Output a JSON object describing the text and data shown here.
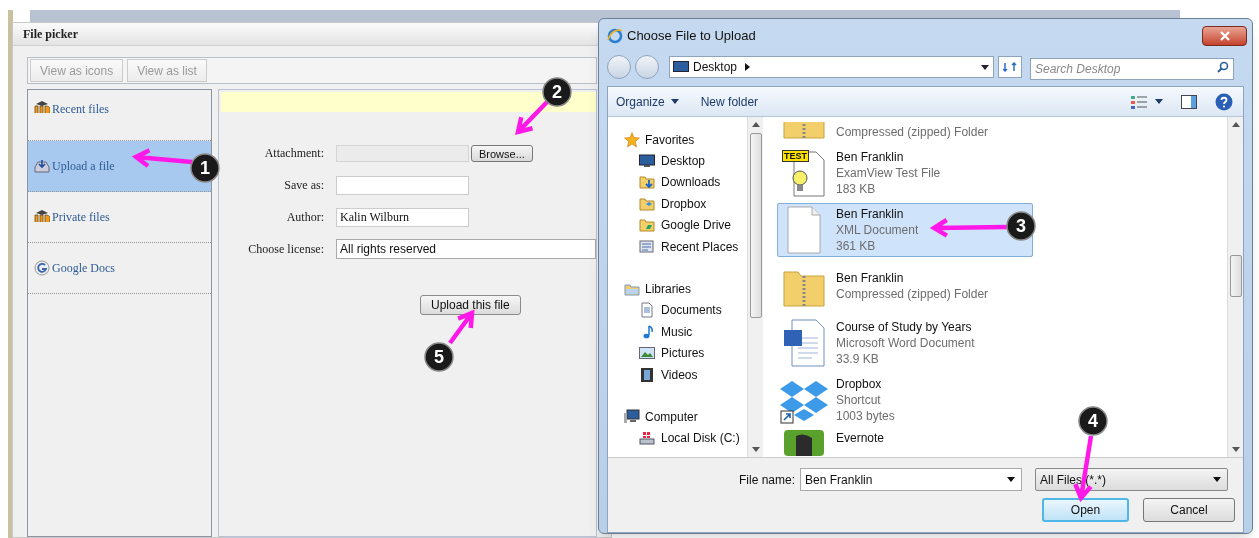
{
  "file_picker": {
    "title": "File picker",
    "view_buttons": [
      "View as icons",
      "View as list"
    ],
    "sources": [
      {
        "label": "Recent files",
        "kind": "moodle",
        "selected": false
      },
      {
        "label": "Upload a file",
        "kind": "upload",
        "selected": true
      },
      {
        "label": "Private files",
        "kind": "moodle",
        "selected": false
      },
      {
        "label": "Google Docs",
        "kind": "google",
        "selected": false
      }
    ],
    "form": {
      "fields": [
        {
          "label": "Attachment:",
          "kind": "file",
          "button": "Browse..."
        },
        {
          "label": "Save as:",
          "kind": "text"
        },
        {
          "label": "Author:",
          "kind": "text",
          "value": "Kalin Wilburn"
        },
        {
          "label": "Choose license:",
          "kind": "select",
          "value": "All rights reserved"
        }
      ],
      "submit": "Upload this file"
    }
  },
  "upload_dialog": {
    "title": "Choose File to Upload",
    "address": "Desktop",
    "search": {
      "placeholder": "Search Desktop"
    },
    "toolbar": [
      {
        "label": "Organize",
        "kind": "menu"
      },
      {
        "label": "New folder",
        "kind": "plain"
      }
    ],
    "nav": [
      {
        "label": "Favorites",
        "kind": "star",
        "children": [
          {
            "label": "Desktop",
            "kind": "desktop"
          },
          {
            "label": "Downloads",
            "kind": "download"
          },
          {
            "label": "Dropbox",
            "kind": "dropbox"
          },
          {
            "label": "Google Drive",
            "kind": "drive"
          },
          {
            "label": "Recent Places",
            "kind": "recent"
          }
        ]
      },
      {
        "label": "Libraries",
        "kind": "library",
        "children": [
          {
            "label": "Documents",
            "kind": "document"
          },
          {
            "label": "Music",
            "kind": "music"
          },
          {
            "label": "Pictures",
            "kind": "picture"
          },
          {
            "label": "Videos",
            "kind": "video"
          }
        ]
      },
      {
        "label": "Computer",
        "kind": "computer",
        "children": [
          {
            "label": "Local Disk (C:)",
            "kind": "disk"
          }
        ]
      }
    ],
    "files": [
      {
        "type": "Compressed (zipped) Folder",
        "kind": "zip",
        "selected": false
      },
      {
        "name": "Ben Franklin",
        "type": "ExamView Test File",
        "size": "183 KB",
        "kind": "test",
        "icon_label": "TEST",
        "selected": false
      },
      {
        "name": "Ben Franklin",
        "type": "XML Document",
        "size": "361 KB",
        "kind": "blank",
        "selected": true
      },
      {
        "name": "Ben Franklin",
        "type": "Compressed (zipped) Folder",
        "kind": "zip",
        "selected": false
      },
      {
        "name": "Course of Study by Years",
        "type": "Microsoft Word Document",
        "size": "33.9 KB",
        "kind": "word",
        "selected": false
      },
      {
        "name": "Dropbox",
        "type": "Shortcut",
        "size": "1003 bytes",
        "kind": "dropbox",
        "selected": false
      },
      {
        "name": "Evernote",
        "kind": "evernote",
        "selected": false
      }
    ],
    "file_name": {
      "label": "File name:",
      "value": "Ben Franklin"
    },
    "filter": "All Files (*.*)",
    "buttons": [
      {
        "label": "Open",
        "kind": "default"
      },
      {
        "label": "Cancel",
        "kind": "plain"
      }
    ]
  },
  "callouts": [
    "1",
    "2",
    "3",
    "4",
    "5"
  ]
}
